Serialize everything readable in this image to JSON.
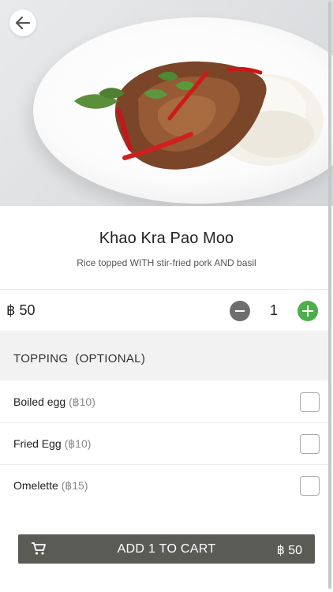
{
  "dish": {
    "name": "Khao Kra Pao Moo",
    "description": "Rice topped WITH stir-fried pork AND basil",
    "price": "฿ 50"
  },
  "quantity": {
    "value": "1"
  },
  "toppings": {
    "title": "TOPPING  (OPTIONAL)",
    "options": [
      {
        "label": "Boiled egg",
        "price": "(฿10)",
        "checked": false
      },
      {
        "label": "Fried Egg",
        "price": "(฿10)",
        "checked": false
      },
      {
        "label": "Omelette",
        "price": "(฿15)",
        "checked": false
      }
    ]
  },
  "cart_button": {
    "label": "ADD 1 TO CART",
    "price": "฿ 50"
  },
  "icons": {
    "back": "arrow-left-icon",
    "minus": "minus-circle-icon",
    "plus": "plus-circle-icon",
    "cart": "cart-icon"
  },
  "colors": {
    "add_button": "#5b5b55",
    "plus_button": "#4cae4c",
    "minus_button": "#6e6e6e",
    "topping_header_bg": "#f2f2f2"
  }
}
